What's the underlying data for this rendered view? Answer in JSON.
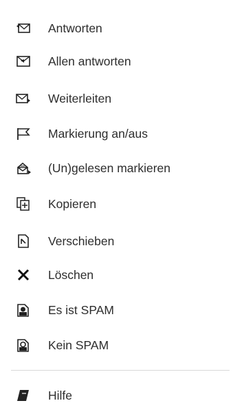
{
  "context_menu": {
    "items": [
      {
        "label": "Antworten",
        "icon": "reply-icon"
      },
      {
        "label": "Allen antworten",
        "icon": "reply-all-icon"
      },
      {
        "label": "Weiterleiten",
        "icon": "forward-icon"
      },
      {
        "label": "Markierung an/aus",
        "icon": "flag-icon"
      },
      {
        "label": "(Un)gelesen markieren",
        "icon": "mark-read-icon"
      },
      {
        "label": "Kopieren",
        "icon": "copy-icon"
      },
      {
        "label": "Verschieben",
        "icon": "move-icon"
      },
      {
        "label": "Löschen",
        "icon": "delete-icon"
      },
      {
        "label": "Es ist SPAM",
        "icon": "spam-icon"
      },
      {
        "label": "Kein SPAM",
        "icon": "not-spam-icon"
      },
      {
        "label": "Hilfe",
        "icon": "help-book-icon"
      }
    ]
  }
}
